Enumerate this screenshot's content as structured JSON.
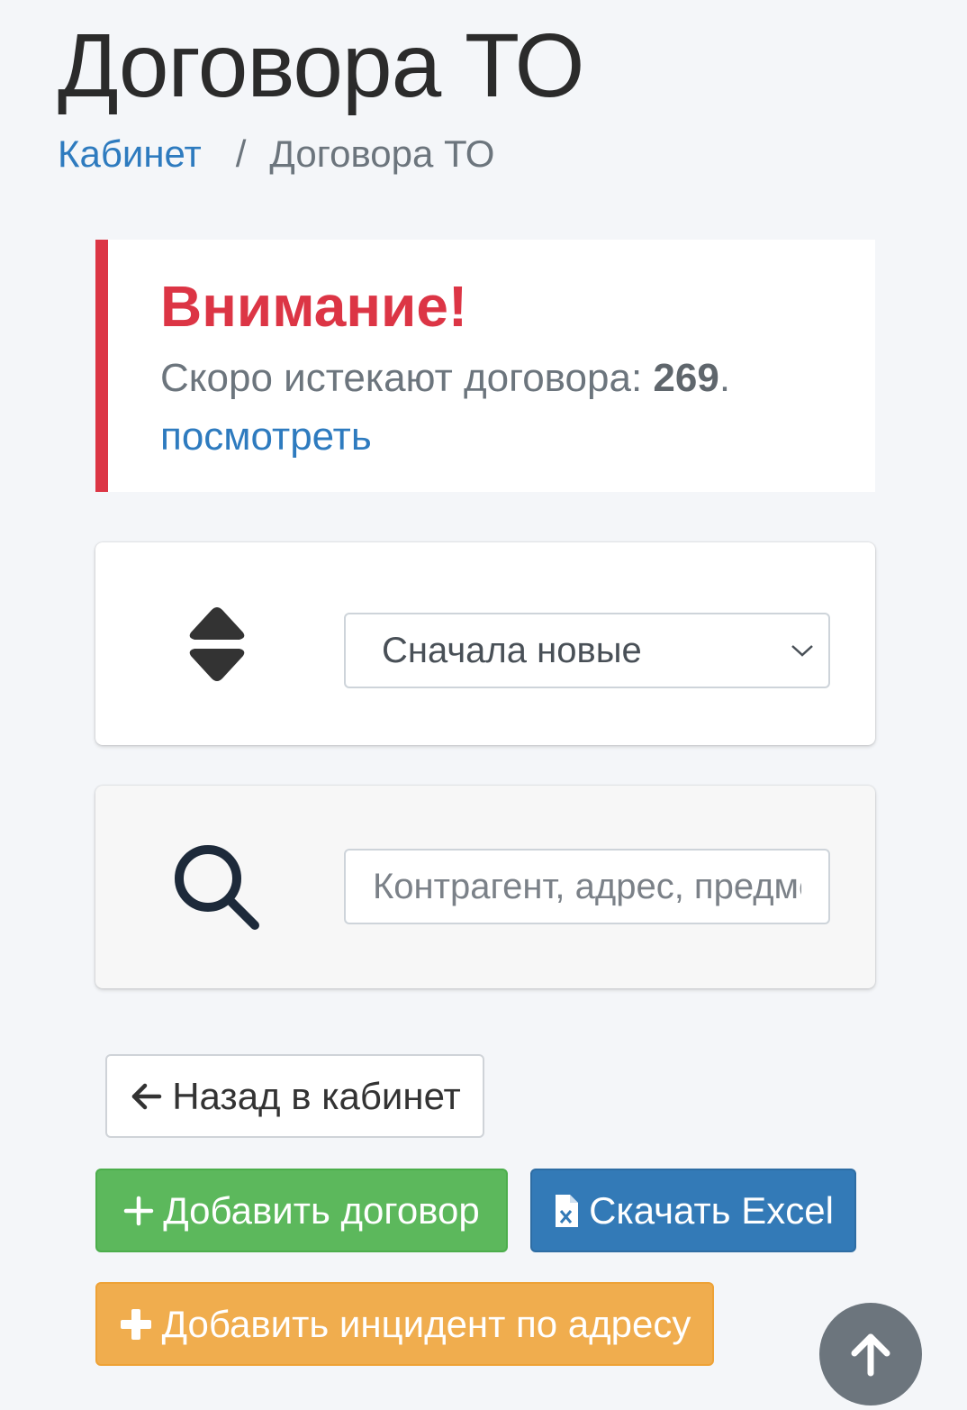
{
  "page": {
    "title": "Договора ТО"
  },
  "breadcrumb": {
    "home_label": "Кабинет",
    "separator": "/",
    "current_label": "Договора ТО"
  },
  "alert": {
    "heading": "Внимание!",
    "message_prefix": "Скоро истекают договора: ",
    "count": "269",
    "message_suffix": ".",
    "link_label": "посмотреть",
    "accent_color": "#dc3545"
  },
  "sort": {
    "icon": "sort-icon",
    "selected": "Сначала новые"
  },
  "search": {
    "icon": "search-icon",
    "placeholder": "Контрагент, адрес, предмет"
  },
  "actions": {
    "back_label": "Назад в кабинет",
    "add_contract_label": "Добавить договор",
    "excel_label": "Скачать Excel",
    "add_incident_label": "Добавить инцидент по адресу"
  },
  "colors": {
    "success": "#5cb85c",
    "primary": "#337ab7",
    "warning": "#f0ad4e",
    "link": "#2e7bbf"
  }
}
